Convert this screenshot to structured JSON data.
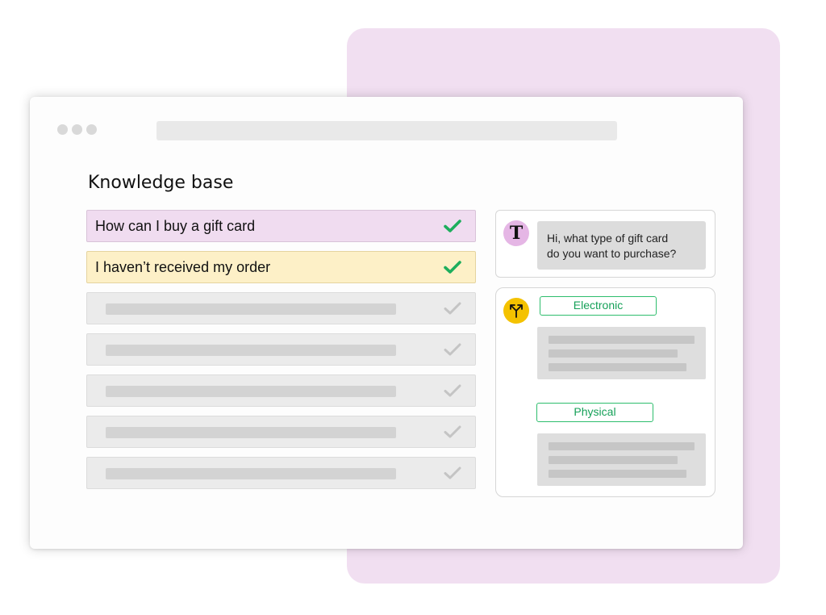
{
  "page": {
    "title": "Knowledge base"
  },
  "kb_items": [
    {
      "label": "How can I buy a gift card",
      "state": "active",
      "highlight": "#f0dcf0",
      "check_color": "#1eae5d"
    },
    {
      "label": "I haven’t received my order",
      "state": "active",
      "highlight": "#fdf0c7",
      "check_color": "#1eae5d"
    },
    {
      "label": "",
      "state": "placeholder",
      "check_color": "#c4c4c4"
    },
    {
      "label": "",
      "state": "placeholder",
      "check_color": "#c4c4c4"
    },
    {
      "label": "",
      "state": "placeholder",
      "check_color": "#c4c4c4"
    },
    {
      "label": "",
      "state": "placeholder",
      "check_color": "#c4c4c4"
    },
    {
      "label": "",
      "state": "placeholder",
      "check_color": "#c4c4c4"
    }
  ],
  "chat": {
    "avatar_letter": "T",
    "message_line1": "Hi, what type of gift card",
    "message_line2": "do you want to purchase?"
  },
  "branch": {
    "icon": "split-arrows-icon",
    "options": [
      "Electronic",
      "Physical"
    ]
  },
  "colors": {
    "background_card": "#f1dff1",
    "accent_green": "#1eae5d",
    "avatar_pink": "#e5b6e5",
    "avatar_yellow": "#f4c200"
  }
}
